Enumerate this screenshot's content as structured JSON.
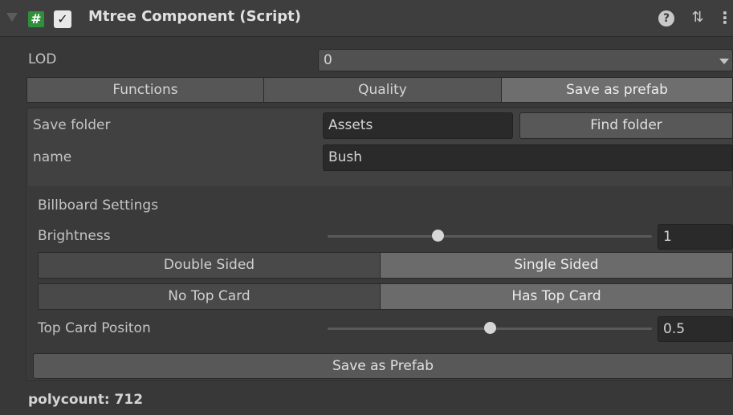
{
  "header": {
    "title": "Mtree Component (Script)",
    "enabled": true,
    "script_icon": "#",
    "check_glyph": "✓",
    "help_glyph": "?",
    "presets_glyph": "⇅",
    "menu_glyph": "⋮"
  },
  "lod": {
    "label": "LOD",
    "value": "0"
  },
  "tabs": [
    {
      "label": "Functions",
      "active": false
    },
    {
      "label": "Quality",
      "active": false
    },
    {
      "label": "Save as prefab",
      "active": true
    }
  ],
  "save": {
    "folder_label": "Save folder",
    "folder_value": "Assets",
    "find_folder_label": "Find folder",
    "name_label": "name",
    "name_value": "Bush"
  },
  "billboard": {
    "section_label": "Billboard Settings",
    "brightness_label": "Brightness",
    "brightness_value": "1",
    "brightness_fraction": 0.34,
    "double_sided_label": "Double Sided",
    "single_sided_label": "Single Sided",
    "no_top_card_label": "No Top Card",
    "has_top_card_label": "Has Top Card",
    "top_card_position_label": "Top Card Positon",
    "top_card_position_value": "0.5",
    "top_card_position_fraction": 0.5
  },
  "save_prefab_button": "Save as Prefab",
  "polycount": "polycount: 712",
  "colors": {
    "script_icon_green": "#2f8f3a",
    "active_tab": "#6e6e6e",
    "background": "#383838"
  }
}
